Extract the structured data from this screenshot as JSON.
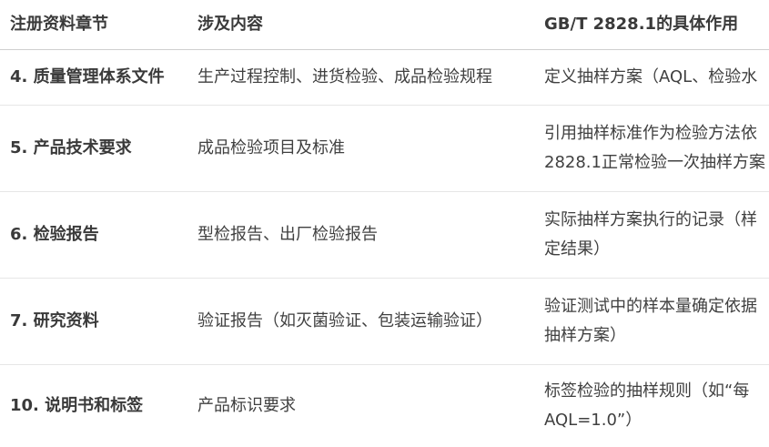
{
  "header": {
    "col1": "注册资料章节",
    "col2": "涉及内容",
    "col3": "GB/T 2828.1的具体作用"
  },
  "rows": [
    {
      "chapter": "4. 质量管理体系文件",
      "content": "生产过程控制、进货检验、成品检验规程",
      "role_lines": [
        "定义抽样方案（AQL、检验水"
      ]
    },
    {
      "chapter": "5. 产品技术要求",
      "content": "成品检验项目及标准",
      "role_lines": [
        "引用抽样标准作为检验方法依",
        "2828.1正常检验一次抽样方案"
      ]
    },
    {
      "chapter": "6. 检验报告",
      "content": "型检报告、出厂检验报告",
      "role_lines": [
        "实际抽样方案执行的记录（样",
        "定结果）"
      ]
    },
    {
      "chapter": "7. 研究资料",
      "content": "验证报告（如灭菌验证、包装运输验证）",
      "role_lines": [
        "验证测试中的样本量确定依据",
        "抽样方案）"
      ]
    },
    {
      "chapter": "10. 说明书和标签",
      "content": "产品标识要求",
      "role_lines": [
        "标签检验的抽样规则（如“每",
        "AQL=1.0”）"
      ]
    }
  ]
}
